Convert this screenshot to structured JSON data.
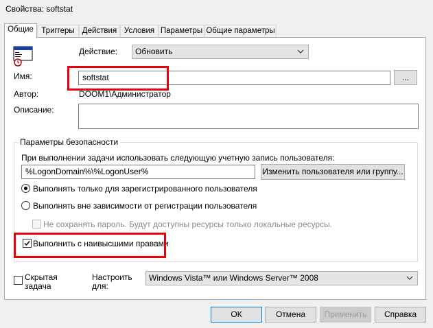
{
  "window": {
    "title": "Свойства: softstat"
  },
  "tabs": [
    "Общие",
    "Триггеры",
    "Действия",
    "Условия",
    "Параметры",
    "Общие параметры"
  ],
  "general": {
    "action_label": "Действие:",
    "action_value": "Обновить",
    "name_label": "Имя:",
    "name_value": "softstat",
    "browse_label": "...",
    "author_label": "Автор:",
    "author_value": "DOOM1\\Администратор",
    "description_label": "Описание:",
    "description_value": ""
  },
  "security": {
    "group_label": "Параметры безопасности",
    "account_prompt": "При выполнении задачи использовать следующую учетную запись пользователя:",
    "account_value": "%LogonDomain%\\%LogonUser%",
    "change_user_button": "Изменить пользователя или группу...",
    "radio_logged_on": "Выполнять только для зарегистрированного пользователя",
    "radio_any": "Выполнять вне зависимости от регистрации пользователя",
    "no_store_password": "Не сохранять пароль. Будут доступны ресурсы только локальные ресурсы.",
    "highest_privileges": "Выполнить с наивысшими правами",
    "selected_radio": "logged_on",
    "highest_privileges_checked": true,
    "no_store_password_checked": false
  },
  "bottom": {
    "hidden_label_line1": "Скрытая",
    "hidden_label_line2": "задача",
    "hidden_checked": false,
    "configure_line1": "Настроить",
    "configure_line2": "для:",
    "configure_value": "Windows Vista™ или Windows Server™ 2008"
  },
  "buttons": {
    "ok": "ОК",
    "cancel": "Отмена",
    "apply": "Применить",
    "help": "Справка"
  },
  "colors": {
    "highlight_red": "#e8000d",
    "focus_blue": "#0078d7"
  }
}
